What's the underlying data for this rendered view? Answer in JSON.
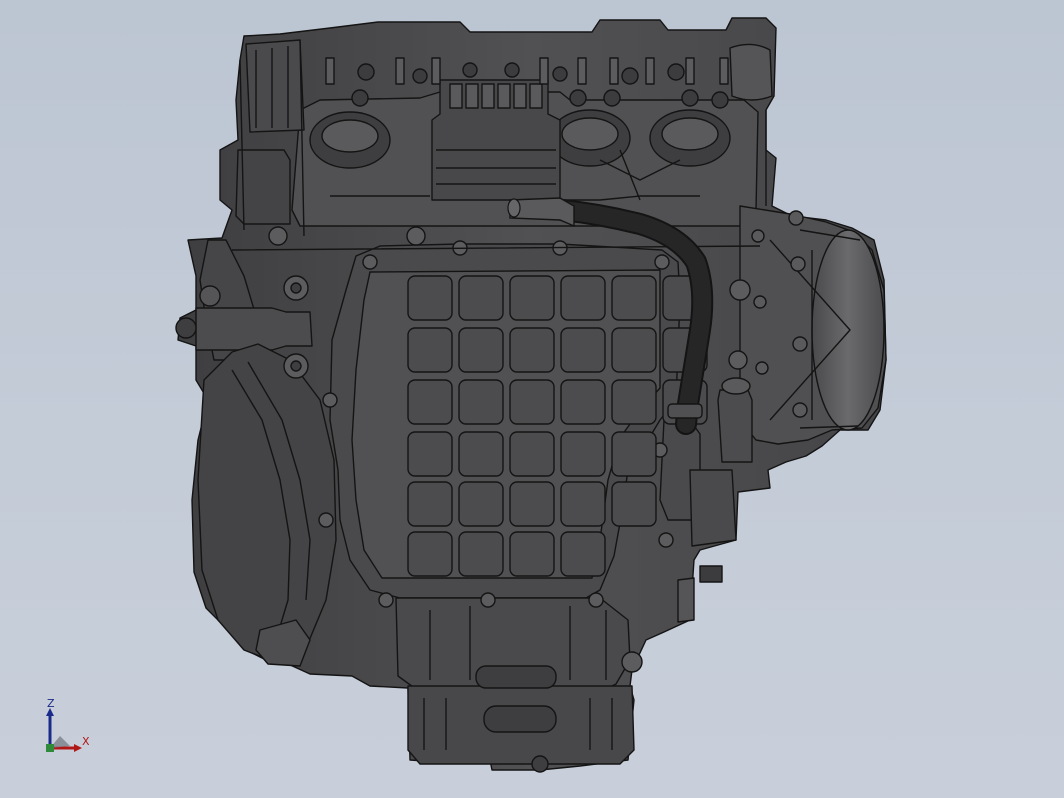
{
  "viewport": {
    "background_top": "#bcc5d2",
    "background_bottom": "#c8cfda"
  },
  "model": {
    "body_color": "#4d4d4f",
    "edge_color": "#141414",
    "hose_color": "#1c1c1c"
  },
  "triad": {
    "z_label": "Z",
    "x_label": "X",
    "z_color": "#1a2a8a",
    "x_color": "#b01818",
    "origin_color": "#2f8a3a"
  }
}
